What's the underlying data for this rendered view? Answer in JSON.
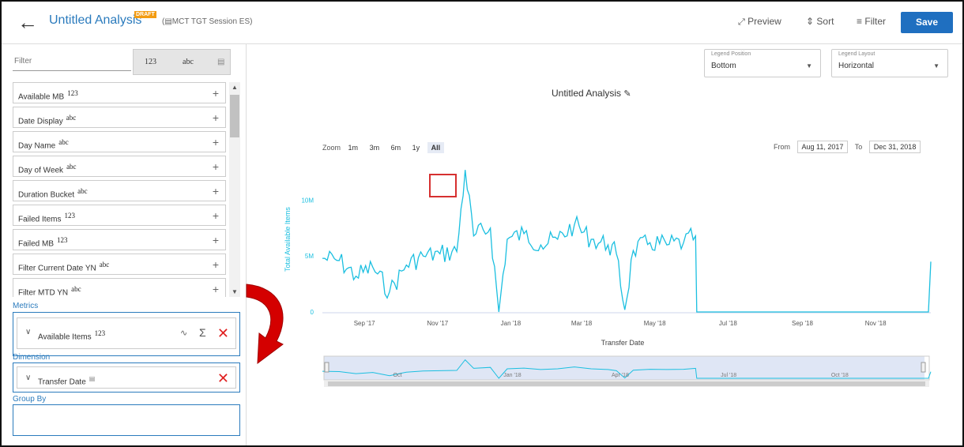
{
  "header": {
    "title": "Untitled Analysis",
    "draft_badge": "DRAFT",
    "session": "(▤MCT TGT Session ES)",
    "preview_label": "Preview",
    "sort_label": "Sort",
    "filter_label": "Filter",
    "save_label": "Save"
  },
  "left": {
    "filter_placeholder": "Filter",
    "type_tabs": [
      "123",
      "abc",
      "▤"
    ],
    "fields": [
      {
        "name": "Available MB",
        "type": "123"
      },
      {
        "name": "Date Display",
        "type": "abc"
      },
      {
        "name": "Day Name",
        "type": "abc"
      },
      {
        "name": "Day of Week",
        "type": "abc"
      },
      {
        "name": "Duration Bucket",
        "type": "abc"
      },
      {
        "name": "Failed Items",
        "type": "123"
      },
      {
        "name": "Failed MB",
        "type": "123"
      },
      {
        "name": "Filter Current Date YN",
        "type": "abc"
      },
      {
        "name": "Filter MTD YN",
        "type": "abc"
      }
    ],
    "metrics_label": "Metrics",
    "metric": {
      "name": "Available Items",
      "type": "123"
    },
    "dimension_label": "Dimension",
    "dimension": {
      "name": "Transfer Date",
      "type": "▤"
    },
    "groupby_label": "Group By"
  },
  "controls": {
    "legend_position_caption": "Legend Position",
    "legend_position_value": "Bottom",
    "legend_layout_caption": "Legend Layout",
    "legend_layout_value": "Horizontal",
    "zoom_label": "Zoom",
    "zoom_buttons": [
      "1m",
      "3m",
      "6m",
      "1y",
      "All"
    ],
    "zoom_active": "All",
    "from_label": "From",
    "from_value": "Aug 11, 2017",
    "to_label": "To",
    "to_value": "Dec 31, 2018"
  },
  "chart_data": {
    "type": "line",
    "title": "Untitled Analysis",
    "xlabel": "Transfer Date",
    "ylabel": "Total Available Items",
    "y_ticks": [
      "0",
      "5M",
      "10M"
    ],
    "x_ticks": [
      "Sep '17",
      "Nov '17",
      "Jan '18",
      "Mar '18",
      "May '18",
      "Jul '18",
      "Sep '18",
      "Nov '18"
    ],
    "navigator_ticks": [
      "Oct",
      "Jan '18",
      "Apr '18",
      "Jul '18",
      "Oct '18"
    ],
    "ylim": [
      0,
      13000000
    ],
    "x_range": [
      "2017-08-11",
      "2018-12-31"
    ],
    "series": [
      {
        "color": "#1bbfe0",
        "points": [
          [
            "2017-08-11",
            4800000
          ],
          [
            "2017-08-25",
            4600000
          ],
          [
            "2017-09-08",
            3200000
          ],
          [
            "2017-09-22",
            4000000
          ],
          [
            "2017-10-06",
            1800000
          ],
          [
            "2017-10-20",
            4200000
          ],
          [
            "2017-11-03",
            5000000
          ],
          [
            "2017-11-17",
            5200000
          ],
          [
            "2017-12-01",
            5400000
          ],
          [
            "2017-12-08",
            12700000
          ],
          [
            "2017-12-15",
            6800000
          ],
          [
            "2017-12-29",
            7500000
          ],
          [
            "2018-01-05",
            0
          ],
          [
            "2018-01-12",
            6500000
          ],
          [
            "2018-01-26",
            7000000
          ],
          [
            "2018-02-09",
            6000000
          ],
          [
            "2018-02-23",
            6500000
          ],
          [
            "2018-03-09",
            7800000
          ],
          [
            "2018-03-23",
            6500000
          ],
          [
            "2018-04-06",
            6000000
          ],
          [
            "2018-04-13",
            5200000
          ],
          [
            "2018-04-20",
            200000
          ],
          [
            "2018-04-27",
            5500000
          ],
          [
            "2018-05-11",
            6200000
          ],
          [
            "2018-05-25",
            6000000
          ],
          [
            "2018-06-08",
            6200000
          ],
          [
            "2018-06-18",
            6800000
          ],
          [
            "2018-06-19",
            0
          ],
          [
            "2018-12-29",
            0
          ],
          [
            "2018-12-31",
            4500000
          ]
        ]
      }
    ]
  }
}
